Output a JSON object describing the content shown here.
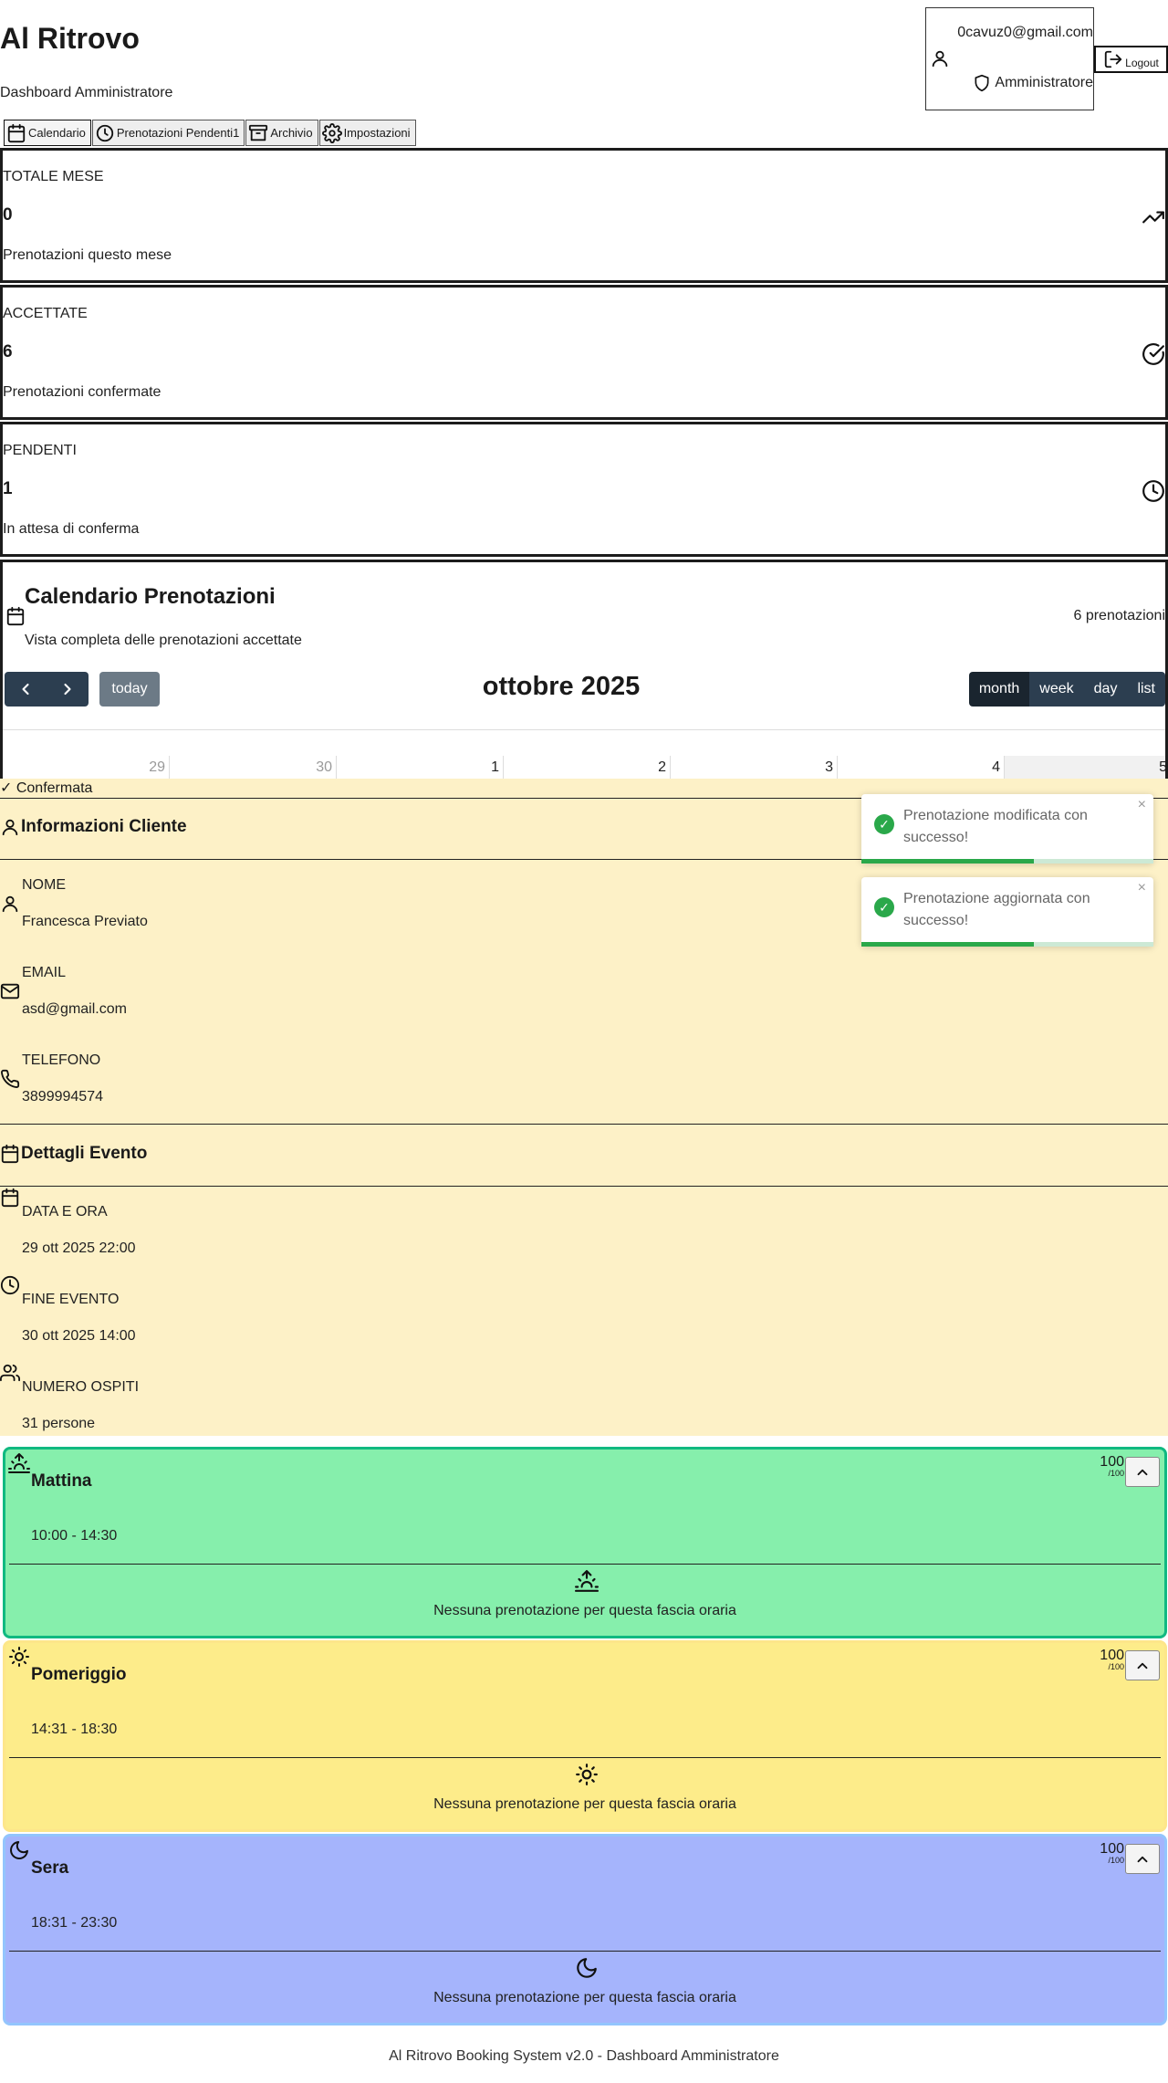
{
  "header": {
    "title": "Al Ritrovo",
    "subtitle": "Dashboard Amministratore",
    "user_email": "0cavuz0@gmail.com",
    "user_role": "Amministratore",
    "logout_label": "Logout"
  },
  "tabs": [
    {
      "label": "Calendario",
      "icon": "calendar-icon",
      "active": true
    },
    {
      "label": "Prenotazioni Pendenti1",
      "icon": "clock-icon",
      "active": false
    },
    {
      "label": "Archivio",
      "icon": "archive-icon",
      "active": false
    },
    {
      "label": "Impostazioni",
      "icon": "gear-icon",
      "active": false
    }
  ],
  "stats": [
    {
      "label": "TOTALE MESE",
      "value": "0",
      "desc": "Prenotazioni questo mese",
      "icon": "trending-up-icon"
    },
    {
      "label": "ACCETTATE",
      "value": "6",
      "desc": "Prenotazioni confermate",
      "icon": "check-circle-icon"
    },
    {
      "label": "PENDENTI",
      "value": "1",
      "desc": "In attesa di conferma",
      "icon": "clock-icon"
    }
  ],
  "calendar": {
    "title": "Calendario Prenotazioni",
    "subtitle": "Vista completa delle prenotazioni accettate",
    "count": "6 prenotazioni",
    "today_label": "today",
    "month_title": "ottobre 2025",
    "views": [
      "month",
      "week",
      "day",
      "list"
    ],
    "active_view": "month",
    "days": [
      "29",
      "30",
      "1",
      "2",
      "3",
      "4",
      "5"
    ]
  },
  "detail": {
    "status": "✓ Confermata",
    "client_section": "Informazioni Cliente",
    "name_label": "NOME",
    "name_value": "Francesca Previato",
    "email_label": "EMAIL",
    "email_value": "asd@gmail.com",
    "phone_label": "TELEFONO",
    "phone_value": "3899994574",
    "event_section": "Dettagli Evento",
    "date_label": "DATA E ORA",
    "date_value": "29 ott 2025 22:00",
    "end_label": "FINE EVENTO",
    "end_value": "30 ott 2025 14:00",
    "guests_label": "NUMERO OSPITI",
    "guests_value": "31 persone"
  },
  "toasts": [
    {
      "text": "Prenotazione modificata con successo!",
      "progress": 0.59
    },
    {
      "text": "Prenotazione aggiornata con successo!",
      "progress": 0.59
    }
  ],
  "slots": [
    {
      "name": "Mattina",
      "time": "10:00 - 14:30",
      "capacity": "100",
      "capacity_max": "/100",
      "empty": "Nessuna prenotazione per questa fascia oraria",
      "icon": "sunrise-icon",
      "color": "#86efac",
      "border": "#10b981"
    },
    {
      "name": "Pomeriggio",
      "time": "14:31 - 18:30",
      "capacity": "100",
      "capacity_max": "/100",
      "empty": "Nessuna prenotazione per questa fascia oraria",
      "icon": "sun-icon",
      "color": "#fdec8a",
      "border": "#fde68a"
    },
    {
      "name": "Sera",
      "time": "18:31 - 23:30",
      "capacity": "100",
      "capacity_max": "/100",
      "empty": "Nessuna prenotazione per questa fascia oraria",
      "icon": "moon-icon",
      "color": "#a5b4fc",
      "border": "#93c5fd"
    }
  ],
  "footer": "Al Ritrovo Booking System v2.0 - Dashboard Amministratore"
}
